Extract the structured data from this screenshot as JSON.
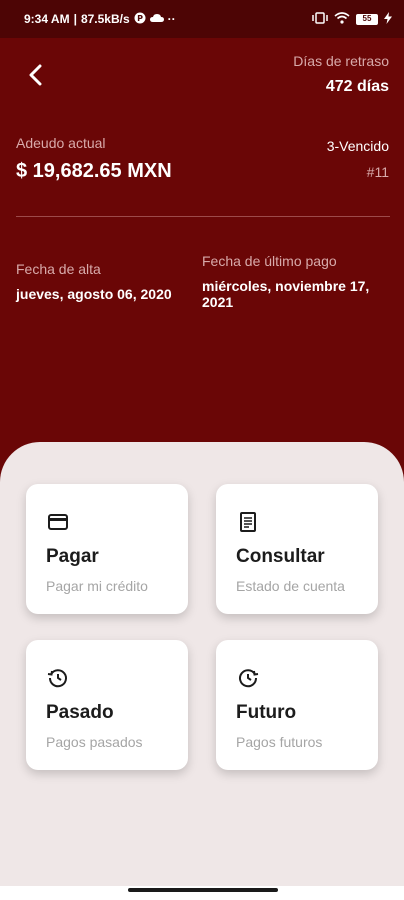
{
  "status_bar": {
    "time": "9:34 AM",
    "speed": "87.5kB/s",
    "more": "··",
    "battery": "55"
  },
  "header": {
    "delay_label": "Días de retraso",
    "delay_value": "472 días",
    "debt_label": "Adeudo actual",
    "debt_value": "$ 19,682.65 MXN",
    "status_label": "3-Vencido",
    "status_id": "#11",
    "start_label": "Fecha de alta",
    "start_value": "jueves, agosto 06, 2020",
    "last_payment_label": "Fecha de último pago",
    "last_payment_value": "miércoles, noviembre 17, 2021"
  },
  "cards": [
    {
      "title": "Pagar",
      "subtitle": "Pagar mi crédito",
      "icon": "credit-card-icon"
    },
    {
      "title": "Consultar",
      "subtitle": "Estado de cuenta",
      "icon": "receipt-icon"
    },
    {
      "title": "Pasado",
      "subtitle": "Pagos pasados",
      "icon": "history-icon"
    },
    {
      "title": "Futuro",
      "subtitle": "Pagos futuros",
      "icon": "update-icon"
    }
  ],
  "colors": {
    "header_bg": "#6a0606",
    "status_bar_bg": "#4d0505",
    "panel_bg": "#efe7e7",
    "card_bg": "#ffffff"
  }
}
